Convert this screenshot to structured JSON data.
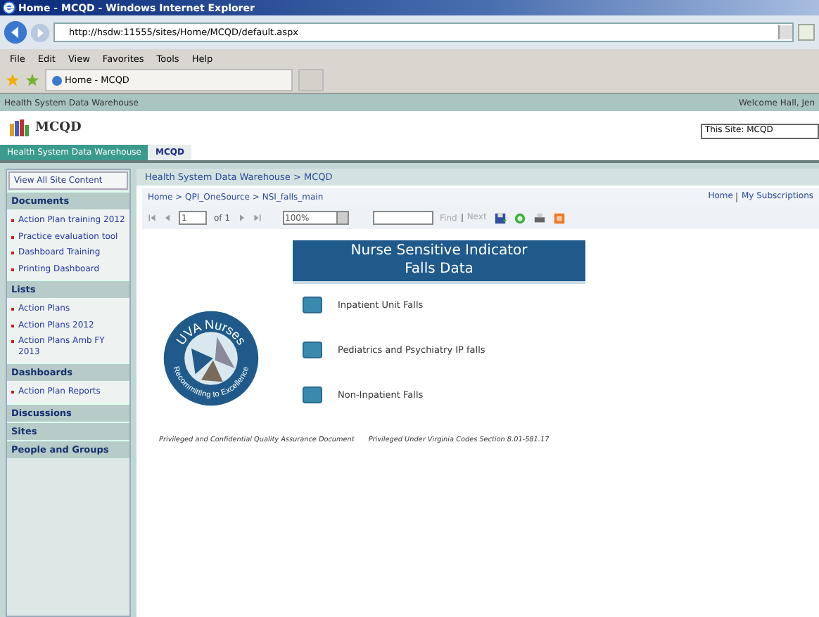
{
  "window": {
    "title": "Home - MCQD - Windows Internet Explorer"
  },
  "browser": {
    "address": "http://hsdw:11555/sites/Home/MCQD/default.aspx",
    "menu": [
      "File",
      "Edit",
      "View",
      "Favorites",
      "Tools",
      "Help"
    ],
    "tab_title": "Home - MCQD"
  },
  "site": {
    "top_link": "Health System Data Warehouse",
    "welcome": "Welcome Hall, Jen",
    "title": "MCQD",
    "scope": "This Site: MCQD",
    "tabs": [
      {
        "label": "Health System Data Warehouse",
        "selected": false
      },
      {
        "label": "MCQD",
        "selected": true
      }
    ],
    "breadcrumb": "Health System Data Warehouse > MCQD"
  },
  "sidebar": {
    "view_all": "View All Site Content",
    "sections": [
      {
        "heading": "Documents",
        "items": [
          "Action Plan training 2012",
          "Practice evaluation tool",
          "Dashboard Training",
          "Printing Dashboard"
        ]
      },
      {
        "heading": "Lists",
        "items": [
          "Action Plans",
          "Action Plans 2012",
          "Action Plans Amb FY 2013"
        ]
      },
      {
        "heading": "Dashboards",
        "items": [
          "Action Plan Reports"
        ]
      },
      {
        "heading": "Discussions"
      },
      {
        "heading": "Sites"
      },
      {
        "heading": "People and Groups"
      }
    ]
  },
  "report": {
    "path": "Home > QPI_OneSource > NSI_falls_main",
    "links": [
      "Home",
      "My Subscriptions"
    ],
    "toolbar": {
      "page": "1",
      "of": "of 1",
      "zoom": "100%",
      "find": "Find",
      "next": "Next"
    },
    "title_lines": [
      "Nurse Sensitive Indicator",
      "Falls Data"
    ],
    "logo": {
      "top": "UVA Nurses",
      "bottom": "Recommitting to Excellence"
    },
    "items": [
      "Inpatient Unit Falls",
      "Pediatrics and Psychiatry IP falls",
      "Non-Inpatient Falls"
    ],
    "footer": [
      "Privileged and Confidential Quality Assurance Document",
      "Privileged Under Virginia Codes Section 8.01-581.17"
    ]
  }
}
